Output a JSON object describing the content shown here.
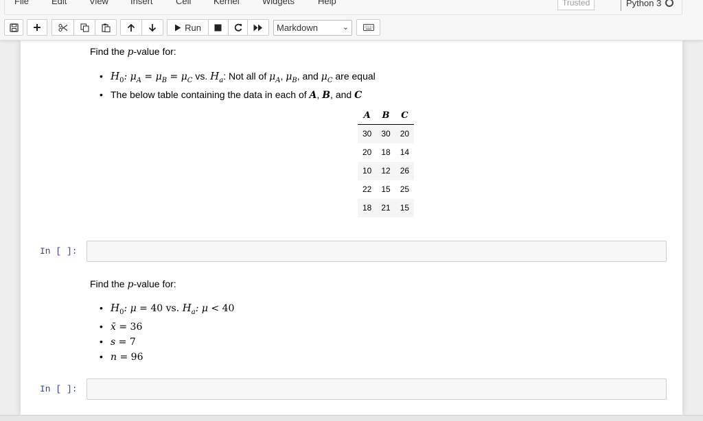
{
  "menu": [
    "File",
    "Edit",
    "View",
    "Insert",
    "Cell",
    "Kernel",
    "Widgets",
    "Help"
  ],
  "header": {
    "trusted": "Trusted",
    "kernel_name": "Python 3"
  },
  "toolbar": {
    "run_label": "Run",
    "cell_type": "Markdown"
  },
  "cell1": {
    "intro_pre": "Find the ",
    "intro_p": "p",
    "intro_post": "-value for:",
    "b1_h0": "H",
    "b1_h0_sub": "0",
    "b1_h0_expr": ": μ",
    "b1_sa": "A",
    "b1_eq1": " = μ",
    "b1_sb": "B",
    "b1_eq2": " = μ",
    "b1_sc": "C",
    "b1_vs": " vs. ",
    "b1_ha": "H",
    "b1_ha_sub": "a",
    "b1_ha_colon": ":",
    "b1_text1": " Not all of ",
    "b1_mu": "μ",
    "b1_comma": ", ",
    "b1_and": ", and ",
    "b1_text2": " are equal",
    "b2_text": "The below table containing the data in each of ",
    "b2_a": "A",
    "b2_b": "B",
    "b2_c": "C",
    "b2_and": ", and "
  },
  "table": {
    "headers": [
      "A",
      "B",
      "C"
    ],
    "rows": [
      [
        "30",
        "30",
        "20"
      ],
      [
        "20",
        "18",
        "14"
      ],
      [
        "10",
        "12",
        "26"
      ],
      [
        "22",
        "15",
        "25"
      ],
      [
        "18",
        "21",
        "15"
      ]
    ]
  },
  "prompt1": "In [ ]:",
  "cell2": {
    "intro_pre": "Find the ",
    "intro_p": "p",
    "intro_post": "-value for:",
    "b1_h0": "H",
    "b1_h0_sub": "0",
    "b1_expr1": ": μ",
    "b1_eq": " = 40",
    "b1_vs": " vs. ",
    "b1_ha": "H",
    "b1_ha_sub": "a",
    "b1_expr2": ": μ",
    "b1_lt": " < 40",
    "b2_var": "x̄",
    "b2_val": " = 36",
    "b3_var": "s",
    "b3_val": " = 7",
    "b4_var": "n",
    "b4_val": " = 96"
  },
  "prompt2": "In [ ]:"
}
